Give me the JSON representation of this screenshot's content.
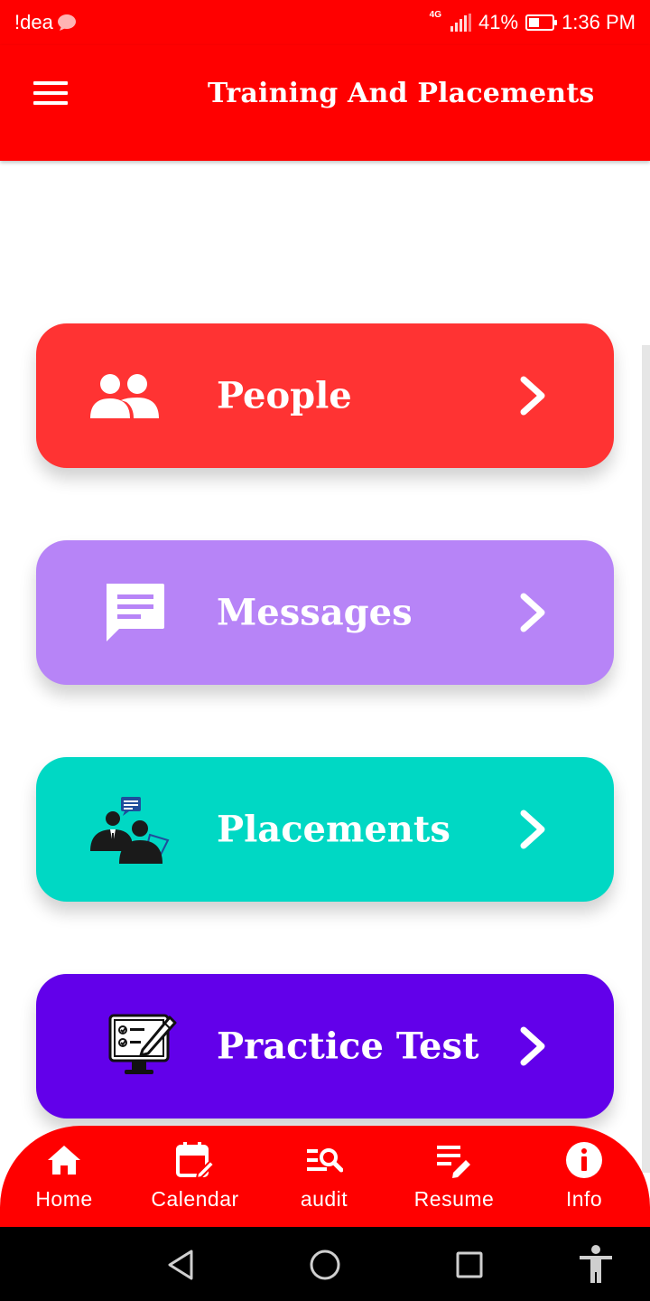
{
  "status_bar": {
    "carrier": "!dea",
    "network": "4G",
    "battery": "41%",
    "battery_level": 0.41,
    "time": "1:36 PM"
  },
  "app_bar": {
    "title": "Training And Placements",
    "menu_icon": "menu-icon"
  },
  "cards": [
    {
      "label": "People",
      "icon": "people-icon",
      "color": "#ff3333"
    },
    {
      "label": "Messages",
      "icon": "message-icon",
      "color": "#b784f7"
    },
    {
      "label": "Placements",
      "icon": "placements-icon",
      "color": "#00d8c4"
    },
    {
      "label": "Practice Test",
      "icon": "practice-test-icon",
      "color": "#6200ea"
    }
  ],
  "bottom_nav": {
    "items": [
      {
        "label": "Home",
        "icon": "home-icon"
      },
      {
        "label": "Calendar",
        "icon": "calendar-edit-icon"
      },
      {
        "label": "audit",
        "icon": "audit-search-icon"
      },
      {
        "label": "Resume",
        "icon": "resume-edit-icon"
      },
      {
        "label": "Info",
        "icon": "info-icon"
      }
    ]
  },
  "colors": {
    "primary": "#ff0000",
    "background": "#ffffff",
    "system_nav": "#000000"
  }
}
